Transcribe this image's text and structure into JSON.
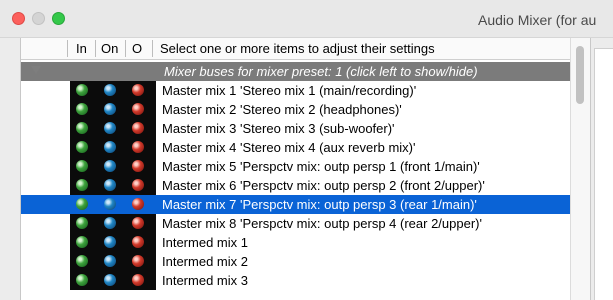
{
  "window": {
    "title": "Audio Mixer (for au"
  },
  "header": {
    "col_in": "In",
    "col_on": "On",
    "col_o": "O",
    "instruction": "Select one or more items to adjust their settings"
  },
  "group_row": {
    "label": "Mixer buses for mixer preset: 1 (click left to show/hide)"
  },
  "rows": [
    {
      "label": "Master mix 1 'Stereo mix 1 (main/recording)'"
    },
    {
      "label": "Master mix 2 'Stereo mix 2 (headphones)'"
    },
    {
      "label": "Master mix 3 'Stereo mix 3 (sub-woofer)'"
    },
    {
      "label": "Master mix 4 'Stereo mix 4 (aux reverb mix)'"
    },
    {
      "label": "Master mix 5 'Perspctv mix: outp persp 1 (front 1/main)'"
    },
    {
      "label": "Master mix 6 'Perspctv mix: outp persp 2 (front 2/upper)'"
    },
    {
      "label": "Master mix 7 'Perspctv mix: outp persp 3 (rear 1/main)'",
      "selected": true
    },
    {
      "label": "Master mix 8 'Perspctv mix: outp persp 4 (rear 2/upper)'"
    },
    {
      "label": "Intermed mix 1"
    },
    {
      "label": "Intermed mix 2"
    },
    {
      "label": "Intermed mix 3"
    }
  ],
  "colors": {
    "selection": "#0a63d6",
    "group_bg": "#7b7b7b",
    "lamp_in": "#3da33c",
    "lamp_on": "#1f86c5",
    "lamp_o": "#d33a2b"
  }
}
